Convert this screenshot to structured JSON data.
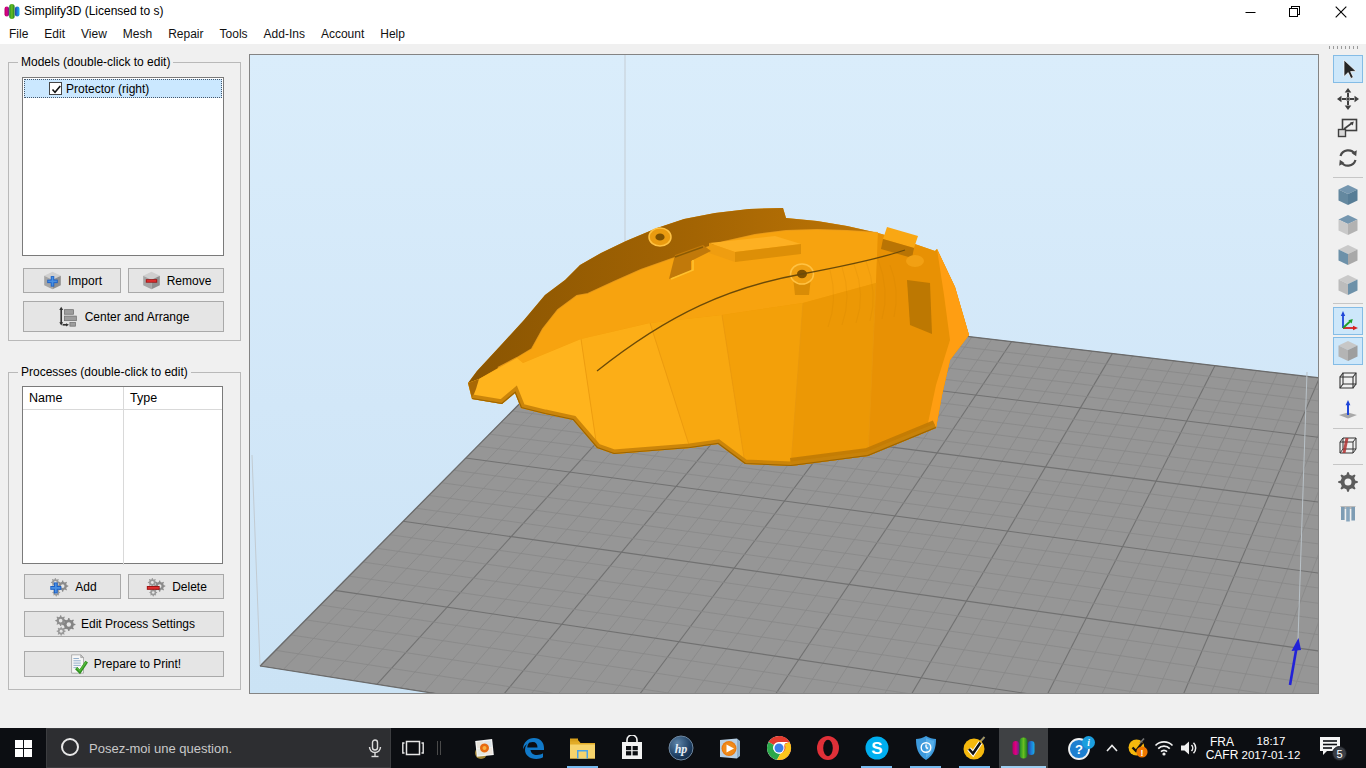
{
  "window": {
    "title": "Simplify3D (Licensed to s)",
    "controls": [
      {
        "name": "minimize",
        "icon": "win-min"
      },
      {
        "name": "restore",
        "icon": "win-restore"
      },
      {
        "name": "close",
        "icon": "win-close"
      }
    ]
  },
  "menu": {
    "items": [
      "File",
      "Edit",
      "View",
      "Mesh",
      "Repair",
      "Tools",
      "Add-Ins",
      "Account",
      "Help"
    ]
  },
  "models_panel": {
    "label": "Models (double-click to edit)",
    "items": [
      {
        "label": "Protector (right)",
        "checked": true,
        "selected": true
      }
    ],
    "import_label": "Import",
    "remove_label": "Remove",
    "center_label": "Center and Arrange"
  },
  "processes_panel": {
    "label": "Processes (double-click to edit)",
    "columns": [
      "Name",
      "Type"
    ],
    "rows": [],
    "add_label": "Add",
    "delete_label": "Delete",
    "edit_label": "Edit Process Settings",
    "prepare_label": "Prepare to Print!"
  },
  "toolbar": {
    "tools": [
      {
        "name": "select-tool",
        "icon": "cursor",
        "selected": true,
        "group": 1
      },
      {
        "name": "move-tool",
        "icon": "move",
        "selected": false,
        "group": 1
      },
      {
        "name": "scale-tool",
        "icon": "scale",
        "selected": false,
        "group": 1
      },
      {
        "name": "rotate-tool",
        "icon": "rotate",
        "selected": false,
        "group": 1
      },
      {
        "name": "view-iso",
        "icon": "cube-iso",
        "selected": false,
        "group": 2
      },
      {
        "name": "view-top",
        "icon": "cube-top",
        "selected": false,
        "group": 2
      },
      {
        "name": "view-front",
        "icon": "cube-front",
        "selected": false,
        "group": 2
      },
      {
        "name": "view-side",
        "icon": "cube-side",
        "selected": false,
        "group": 2
      },
      {
        "name": "show-axes",
        "icon": "axes",
        "selected": true,
        "group": 3
      },
      {
        "name": "solid-render",
        "icon": "cube-solid",
        "selected": true,
        "group": 3
      },
      {
        "name": "wireframe-render",
        "icon": "cube-wire",
        "selected": false,
        "group": 3
      },
      {
        "name": "show-normals",
        "icon": "normal",
        "selected": false,
        "group": 3
      },
      {
        "name": "cross-section",
        "icon": "section",
        "selected": false,
        "group": 4
      },
      {
        "name": "machine-settings",
        "icon": "gear",
        "selected": false,
        "group": 5
      },
      {
        "name": "support-structures",
        "icon": "supports",
        "selected": false,
        "group": 5
      }
    ]
  },
  "viewport": {
    "model": "Protector (right)",
    "colors": {
      "model_orange": "#f8a40e",
      "model_dark": "#8d5702",
      "bed_gray": "#969696",
      "sky_top": "#daedfb",
      "sky_bottom": "#cbe3f5"
    }
  },
  "taskbar": {
    "search_placeholder": "Posez-moi une question.",
    "apps": [
      {
        "name": "photos",
        "icon": "photos",
        "running": false,
        "active": false
      },
      {
        "name": "edge",
        "icon": "edge",
        "running": false,
        "active": false
      },
      {
        "name": "file-explorer",
        "icon": "folder",
        "running": true,
        "active": false
      },
      {
        "name": "store",
        "icon": "store",
        "running": false,
        "active": false
      },
      {
        "name": "hp-support",
        "icon": "hp",
        "running": false,
        "active": false
      },
      {
        "name": "media-player",
        "icon": "wmp",
        "running": false,
        "active": false
      },
      {
        "name": "chrome",
        "icon": "chrome",
        "running": false,
        "active": false
      },
      {
        "name": "opera",
        "icon": "opera",
        "running": false,
        "active": false
      },
      {
        "name": "skype",
        "icon": "skype",
        "running": true,
        "active": false
      },
      {
        "name": "security-shield",
        "icon": "shield",
        "running": true,
        "active": false
      },
      {
        "name": "norton",
        "icon": "norton",
        "running": true,
        "active": false
      },
      {
        "name": "simplify3d",
        "icon": "s3d",
        "running": true,
        "active": true
      }
    ],
    "tray": {
      "language_line1": "FRA",
      "language_line2": "CAFR",
      "time": "18:17",
      "date": "2017-01-12",
      "notification_count": "5"
    }
  }
}
